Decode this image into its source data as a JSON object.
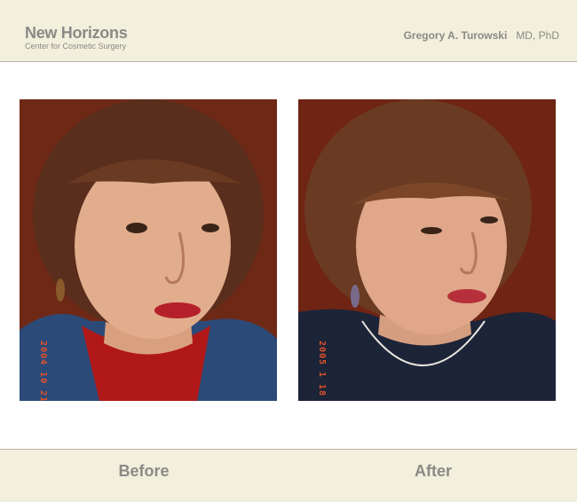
{
  "header": {
    "brand_name": "New Horizons",
    "brand_subtitle": "Center for Cosmetic Surgery",
    "doctor_name": "Gregory A. Turowski",
    "doctor_credentials": "MD, PhD"
  },
  "photos": {
    "before": {
      "date_stamp": "2004 10 21"
    },
    "after": {
      "date_stamp": "2005 1 18"
    }
  },
  "footer": {
    "before_label": "Before",
    "after_label": "After"
  },
  "colors": {
    "header_bg": "#f2efdc",
    "text_gray": "#8a8a86",
    "photo_bg": "#7a2e1a",
    "stamp": "#e0502a"
  }
}
